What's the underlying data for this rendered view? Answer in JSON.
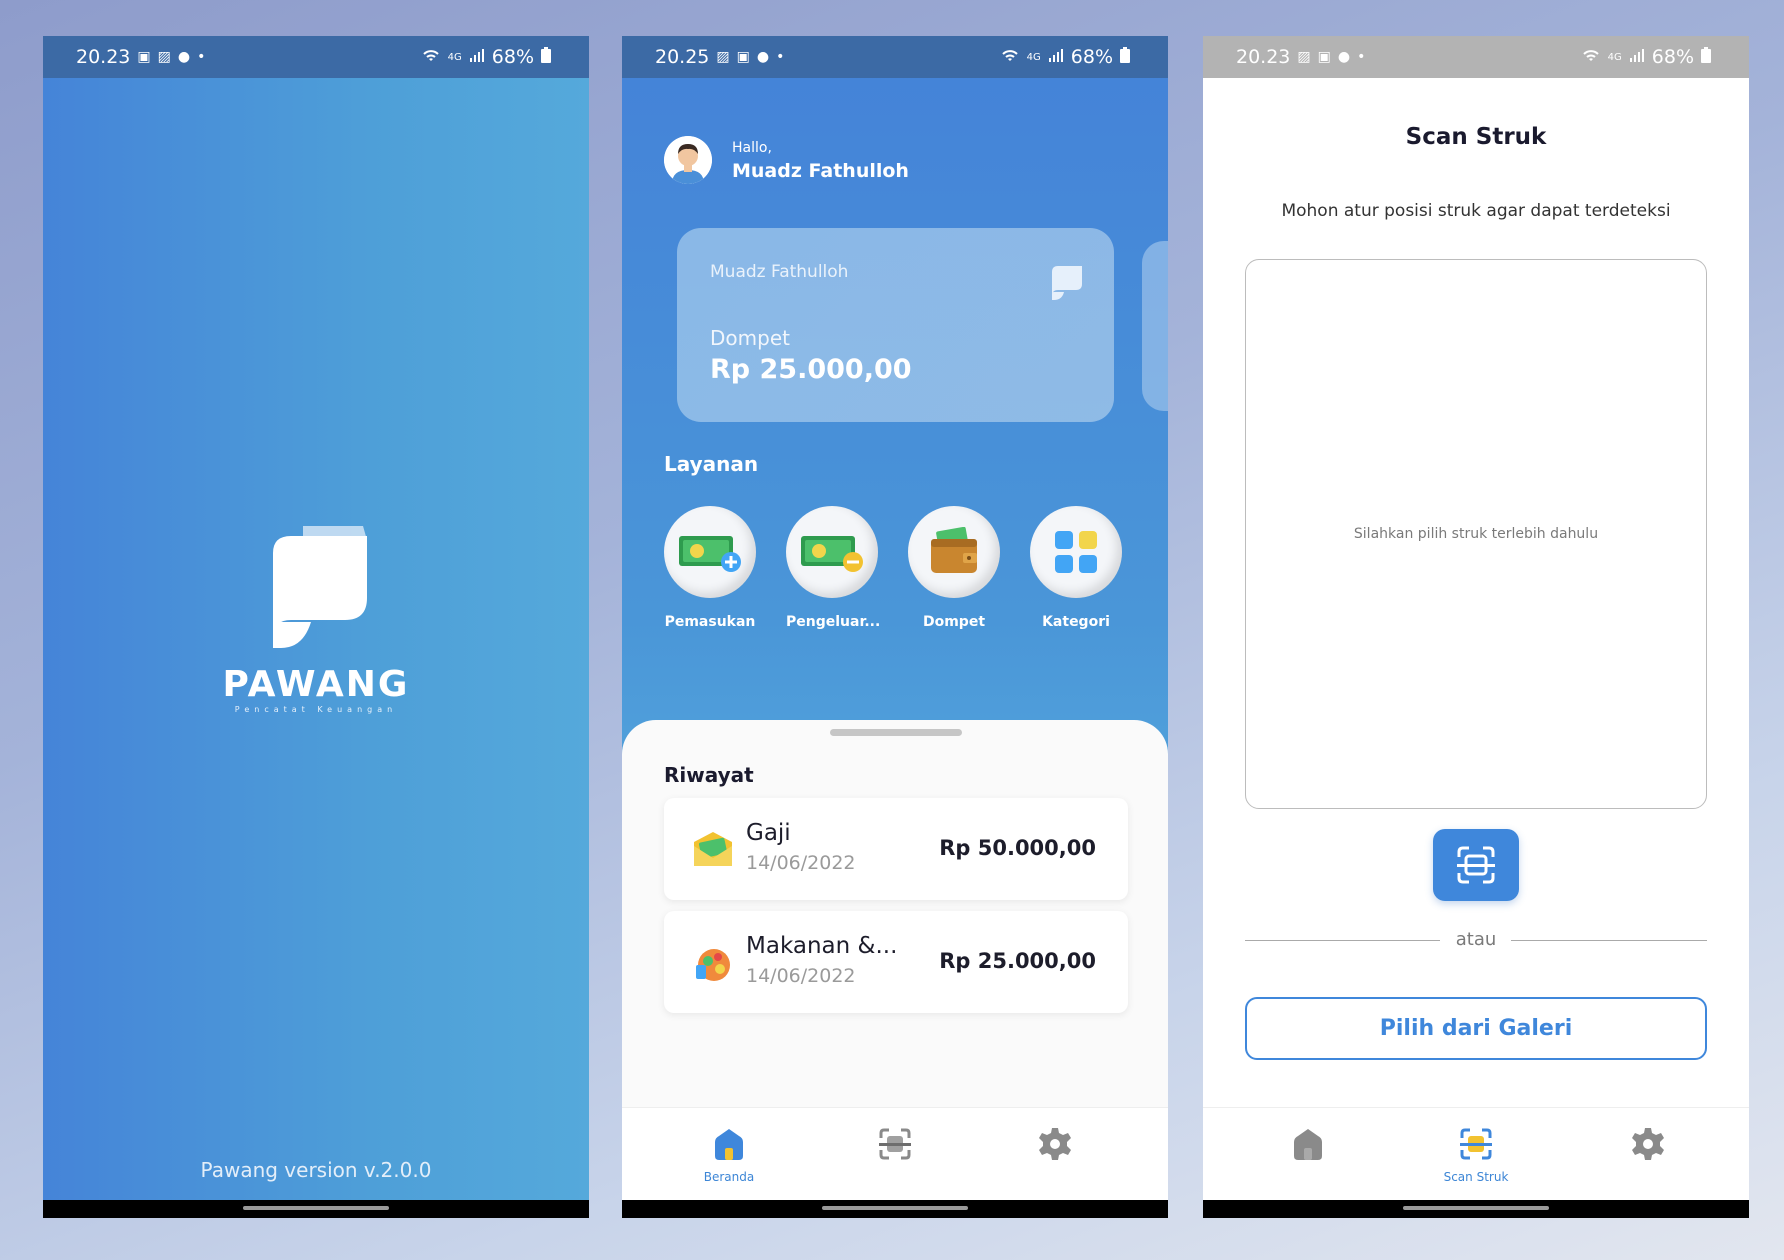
{
  "status_bars": [
    {
      "time": "20.23",
      "network": "4G",
      "battery": "68%"
    },
    {
      "time": "20.25",
      "network": "4G",
      "battery": "68%"
    },
    {
      "time": "20.23",
      "network": "4G",
      "battery": "68%"
    }
  ],
  "splash": {
    "app_name": "PAWANG",
    "tagline": "Pencatat Keuangan",
    "version": "Pawang version v.2.0.0"
  },
  "home": {
    "greeting": "Hallo,",
    "user_name": "Muadz Fathulloh",
    "wallet_card": {
      "owner": "Muadz Fathulloh",
      "label": "Dompet",
      "amount": "Rp 25.000,00"
    },
    "services_title": "Layanan",
    "services": [
      {
        "label": "Pemasukan",
        "icon": "income-money-icon"
      },
      {
        "label": "Pengeluar...",
        "icon": "expense-money-icon"
      },
      {
        "label": "Dompet",
        "icon": "wallet-icon"
      },
      {
        "label": "Kategori",
        "icon": "category-grid-icon"
      }
    ],
    "history_title": "Riwayat",
    "transactions": [
      {
        "name": "Gaji",
        "date": "14/06/2022",
        "amount": "Rp 50.000,00",
        "icon": "salary-envelope-icon"
      },
      {
        "name": "Makanan &...",
        "date": "14/06/2022",
        "amount": "Rp 25.000,00",
        "icon": "food-icon"
      }
    ],
    "tabs": [
      {
        "label": "Beranda",
        "icon": "home-icon",
        "active": true
      },
      {
        "label": "",
        "icon": "scan-icon",
        "active": false
      },
      {
        "label": "",
        "icon": "gear-icon",
        "active": false
      }
    ]
  },
  "scan": {
    "title": "Scan Struk",
    "instruction": "Mohon atur posisi struk agar dapat terdeteksi",
    "frame_hint": "Silahkan pilih struk terlebih dahulu",
    "divider": "atau",
    "gallery_button": "Pilih dari Galeri",
    "tabs": [
      {
        "label": "",
        "icon": "home-icon",
        "active": false
      },
      {
        "label": "Scan Struk",
        "icon": "scan-icon",
        "active": true
      },
      {
        "label": "",
        "icon": "gear-icon",
        "active": false
      }
    ]
  },
  "colors": {
    "primary": "#3f87db",
    "text_dark": "#1a1a2e",
    "muted": "#9a9a9a"
  }
}
